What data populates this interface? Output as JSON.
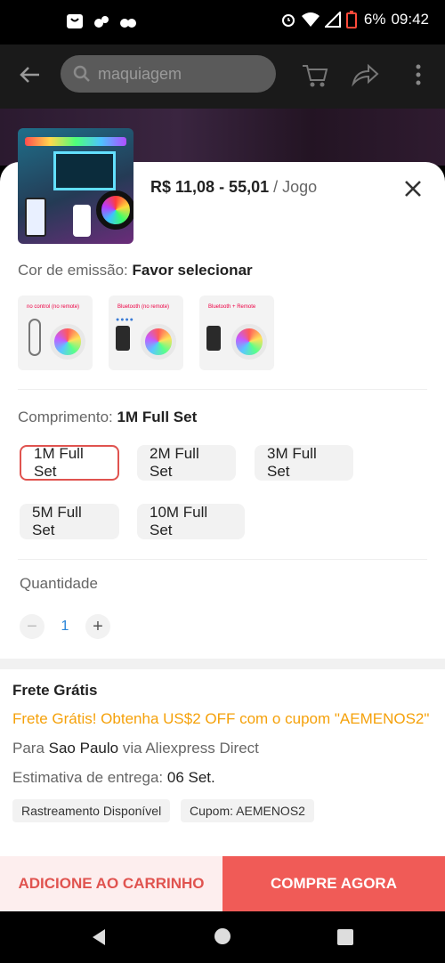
{
  "status_bar": {
    "battery": "6%",
    "time": "09:42"
  },
  "header": {
    "search_placeholder": "maquiagem"
  },
  "product": {
    "price": "R$ 11,08 - 55,01",
    "unit": "/ Jogo",
    "thumbnail_label": "RGB LED STRIP"
  },
  "color": {
    "label": "Cor de emissão:",
    "value": "Favor selecionar",
    "options": [
      {
        "tag": "no control (no remote)"
      },
      {
        "tag": "Bluetooth (no remote)"
      },
      {
        "tag": "Bluetooth + Remote"
      }
    ]
  },
  "length": {
    "label": "Comprimento:",
    "value": "1M Full Set",
    "options": [
      "1M Full Set",
      "2M Full Set",
      "3M Full Set",
      "5M Full Set",
      "10M Full Set"
    ],
    "selected_index": 0
  },
  "quantity": {
    "label": "Quantidade",
    "minus": "−",
    "value": "1",
    "plus": "+"
  },
  "shipping": {
    "title": "Frete Grátis",
    "promo": "Frete Grátis! Obtenha US$2 OFF com o cupom \"AEMENOS2\"",
    "to_prefix": "Para ",
    "to_city": "Sao Paulo",
    "to_suffix": " via Aliexpress Direct",
    "eta_label": "Estimativa de entrega: ",
    "eta_value": "06 Set.",
    "chips": [
      "Rastreamento Disponível",
      "Cupom: AEMENOS2"
    ]
  },
  "actions": {
    "add_to_cart": "ADICIONE AO CARRINHO",
    "buy_now": "COMPRE AGORA"
  },
  "colors": {
    "accent": "#f05b57",
    "promo": "#f5a10a",
    "link": "#2a86d9"
  }
}
